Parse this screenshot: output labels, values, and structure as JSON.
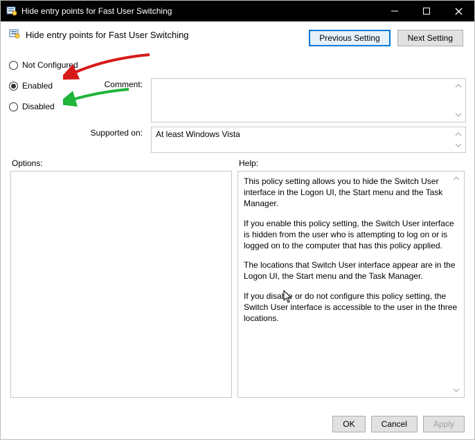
{
  "window": {
    "title": "Hide entry points for Fast User Switching"
  },
  "header": {
    "title": "Hide entry points for Fast User Switching",
    "prev": "Previous Setting",
    "next": "Next Setting"
  },
  "radios": {
    "not_configured": "Not Configured",
    "enabled": "Enabled",
    "disabled": "Disabled",
    "selected": "enabled"
  },
  "labels": {
    "comment": "Comment:",
    "supported": "Supported on:",
    "options": "Options:",
    "help": "Help:"
  },
  "fields": {
    "comment_value": "",
    "supported_value": "At least Windows Vista"
  },
  "help": {
    "p1": "This policy setting allows you to hide the Switch User interface in the Logon UI, the Start menu and the Task Manager.",
    "p2": "If you enable this policy setting, the Switch User interface is hidden from the user who is attempting to log on or is logged on to the computer that has this policy applied.",
    "p3": "The locations that Switch User interface appear are in the Logon UI, the Start menu and the Task Manager.",
    "p4": "If you disable or do not configure this policy setting, the Switch User interface is accessible to the user in the three locations."
  },
  "buttons": {
    "ok": "OK",
    "cancel": "Cancel",
    "apply": "Apply"
  }
}
